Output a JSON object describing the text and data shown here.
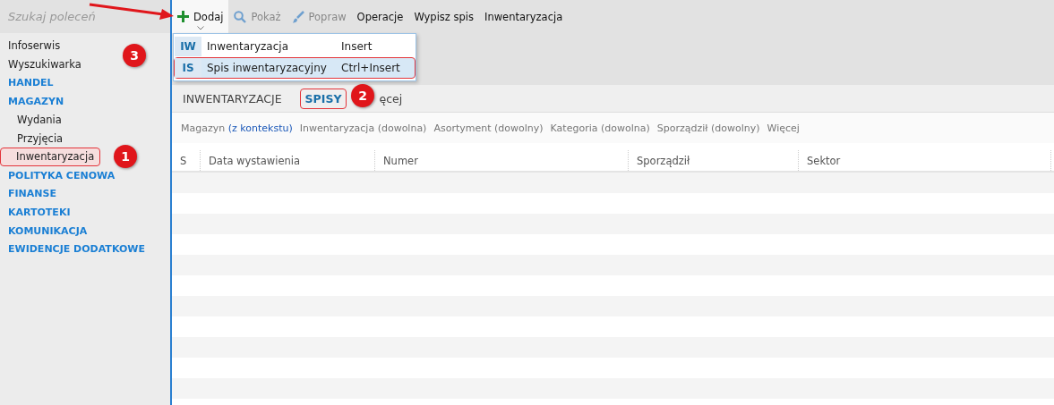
{
  "search": {
    "placeholder": "Szukaj poleceń"
  },
  "sidebar": {
    "items": [
      {
        "label": "Infoserwis",
        "kind": "item",
        "selected": false
      },
      {
        "label": "Wyszukiwarka",
        "kind": "item",
        "selected": false
      },
      {
        "label": "HANDEL",
        "kind": "section",
        "selected": false
      },
      {
        "label": "MAGAZYN",
        "kind": "section",
        "selected": false
      },
      {
        "label": "Wydania",
        "kind": "sub",
        "selected": false
      },
      {
        "label": "Przyjęcia",
        "kind": "sub",
        "selected": false
      },
      {
        "label": "Inwentaryzacja",
        "kind": "sub",
        "selected": true
      },
      {
        "label": "POLITYKA CENOWA",
        "kind": "section",
        "selected": false
      },
      {
        "label": "FINANSE",
        "kind": "section",
        "selected": false
      },
      {
        "label": "KARTOTEKI",
        "kind": "section",
        "selected": false
      },
      {
        "label": "KOMUNIKACJA",
        "kind": "section",
        "selected": false
      },
      {
        "label": "EWIDENCJE DODATKOWE",
        "kind": "section",
        "selected": false
      }
    ]
  },
  "toolbar": [
    {
      "label": "Dodaj",
      "disabled": false,
      "open": true
    },
    {
      "label": "Pokaż",
      "disabled": true,
      "open": false
    },
    {
      "label": "Popraw",
      "disabled": true,
      "open": false
    },
    {
      "label": "Operacje",
      "disabled": false,
      "open": false
    },
    {
      "label": "Wypisz spis",
      "disabled": false,
      "open": false
    },
    {
      "label": "Inwentaryzacja",
      "disabled": false,
      "open": false
    }
  ],
  "menu": {
    "items": [
      {
        "code": "IW",
        "label": "Inwentaryzacja",
        "shortcut": "Insert",
        "selected": false
      },
      {
        "code": "IS",
        "label": "Spis inwentaryzacyjny",
        "shortcut": "Ctrl+Insert",
        "selected": true
      }
    ]
  },
  "tabs": [
    {
      "label": "INWENTARYZACJE",
      "selected": false
    },
    {
      "label": "SPISY",
      "selected": true
    },
    {
      "label": "ęcej",
      "selected": false
    }
  ],
  "filters": [
    {
      "label": "Magazyn",
      "value": "(z kontekstu)",
      "set": true
    },
    {
      "label": "Inwentaryzacja",
      "value": "(dowolna)",
      "set": false
    },
    {
      "label": "Asortyment",
      "value": "(dowolny)",
      "set": false
    },
    {
      "label": "Kategoria",
      "value": "(dowolna)",
      "set": false
    },
    {
      "label": "Sporządził",
      "value": "(dowolny)",
      "set": false
    },
    {
      "label": "Więcej"
    }
  ],
  "table": {
    "columns": [
      "S",
      "Data wystawienia",
      "Numer",
      "Sporządził",
      "Sektor"
    ]
  },
  "callouts": [
    "1",
    "2",
    "3"
  ]
}
